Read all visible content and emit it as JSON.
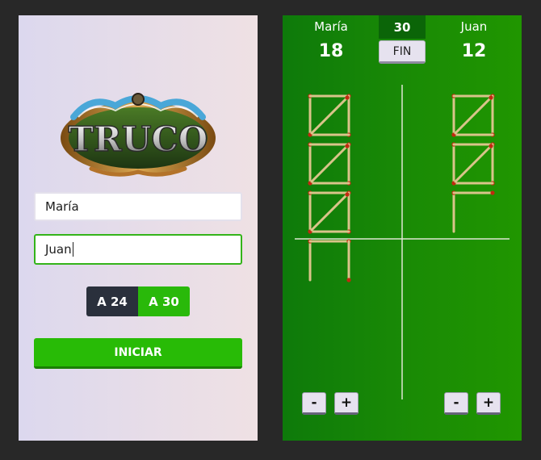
{
  "login": {
    "player1_value": "María",
    "player2_value": "Juan",
    "options": [
      {
        "label": "A 24",
        "selected": false
      },
      {
        "label": "A 30",
        "selected": true
      }
    ],
    "start_label": "INICIAR",
    "logo_text": "TRUCO"
  },
  "scoreboard": {
    "player1": {
      "name": "María",
      "score": "18",
      "minus_label": "-",
      "plus_label": "+"
    },
    "player2": {
      "name": "Juan",
      "score": "12",
      "minus_label": "-",
      "plus_label": "+"
    },
    "goal": "30",
    "end_label": "FIN"
  },
  "colors": {
    "accent_green": "#29b90a",
    "board_green": "#1a8b05",
    "match_tip": "#c02a10",
    "match_stick": "#d9c48a"
  }
}
